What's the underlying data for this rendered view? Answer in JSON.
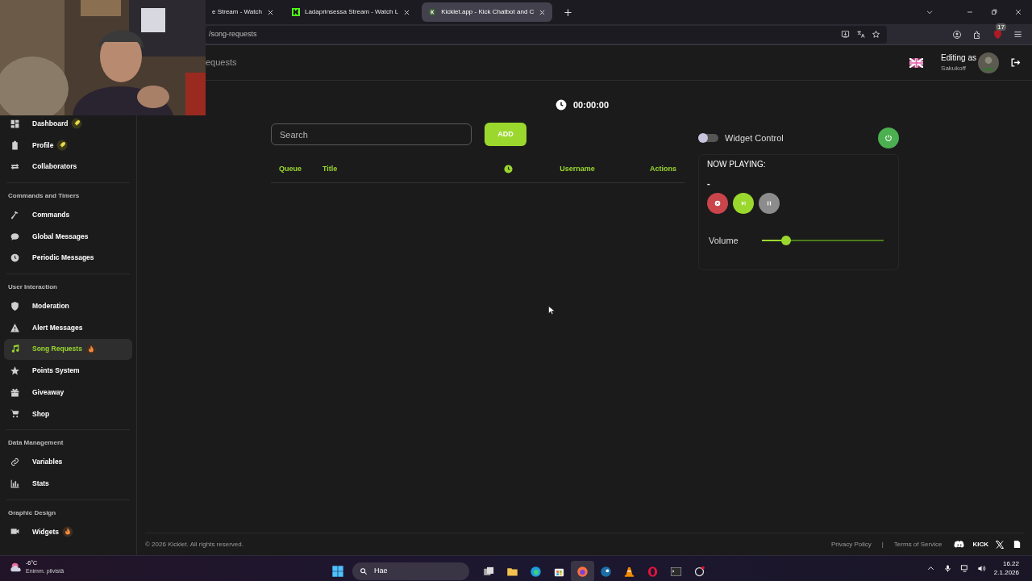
{
  "browser": {
    "tabs": [
      {
        "title": "e Stream - Watch",
        "selected": false
      },
      {
        "title": "Ladaprinsessa Stream - Watch L",
        "selected": false
      },
      {
        "title": "Kicklet.app - Kick Chatbot and C",
        "selected": true
      }
    ],
    "address": "/song-requests",
    "extension_badge": "17"
  },
  "header": {
    "title": "equests",
    "editing_label": "Editing as",
    "username": "Sakukoff"
  },
  "sidebar": [
    {
      "items": [
        {
          "label": "Dashboard",
          "badge": true,
          "selected": false
        },
        {
          "label": "Profile",
          "badge": true,
          "selected": false
        },
        {
          "label": "Collaborators",
          "badge": false,
          "selected": false
        }
      ]
    },
    {
      "heading": "Commands and Timers",
      "items": [
        {
          "label": "Commands",
          "badge": false,
          "selected": false
        },
        {
          "label": "Global Messages",
          "badge": false,
          "selected": false
        },
        {
          "label": "Periodic Messages",
          "badge": false,
          "selected": false
        }
      ]
    },
    {
      "heading": "User Interaction",
      "items": [
        {
          "label": "Moderation",
          "badge": false,
          "selected": false
        },
        {
          "label": "Alert Messages",
          "badge": false,
          "selected": false
        },
        {
          "label": "Song Requests",
          "badge": true,
          "selected": true
        },
        {
          "label": "Points System",
          "badge": false,
          "selected": false
        },
        {
          "label": "Giveaway",
          "badge": false,
          "selected": false
        },
        {
          "label": "Shop",
          "badge": false,
          "selected": false
        }
      ]
    },
    {
      "heading": "Data Management",
      "items": [
        {
          "label": "Variables",
          "badge": false,
          "selected": false
        },
        {
          "label": "Stats",
          "badge": false,
          "selected": false
        }
      ]
    },
    {
      "heading": "Graphic Design",
      "items": [
        {
          "label": "Widgets",
          "badge": true,
          "selected": false
        }
      ]
    }
  ],
  "timer": "00:00:00",
  "search": {
    "placeholder": "Search"
  },
  "add_button": "ADD",
  "table": {
    "columns": [
      {
        "kind": "text",
        "label": "Queue"
      },
      {
        "kind": "text",
        "label": "Title"
      },
      {
        "kind": "icon"
      },
      {
        "kind": "text",
        "label": "Username"
      },
      {
        "kind": "text",
        "label": "Actions"
      }
    ]
  },
  "widget_control": {
    "label": "Widget Control",
    "on": false
  },
  "now_playing": {
    "heading": "NOW PLAYING:",
    "track": "-",
    "volume_label": "Volume",
    "level": 0.2
  },
  "footer": {
    "copyright": "© 2026 Kicklet. All rights reserved.",
    "links": [
      "Privacy Policy",
      "Terms of Service"
    ],
    "separator": "|",
    "kick_logo": "KICK"
  },
  "taskbar": {
    "temperature": "-6°C",
    "weather": "Enimm. pilvistä",
    "search": "Hae",
    "time": "16.22",
    "date": "2.1.2026"
  }
}
